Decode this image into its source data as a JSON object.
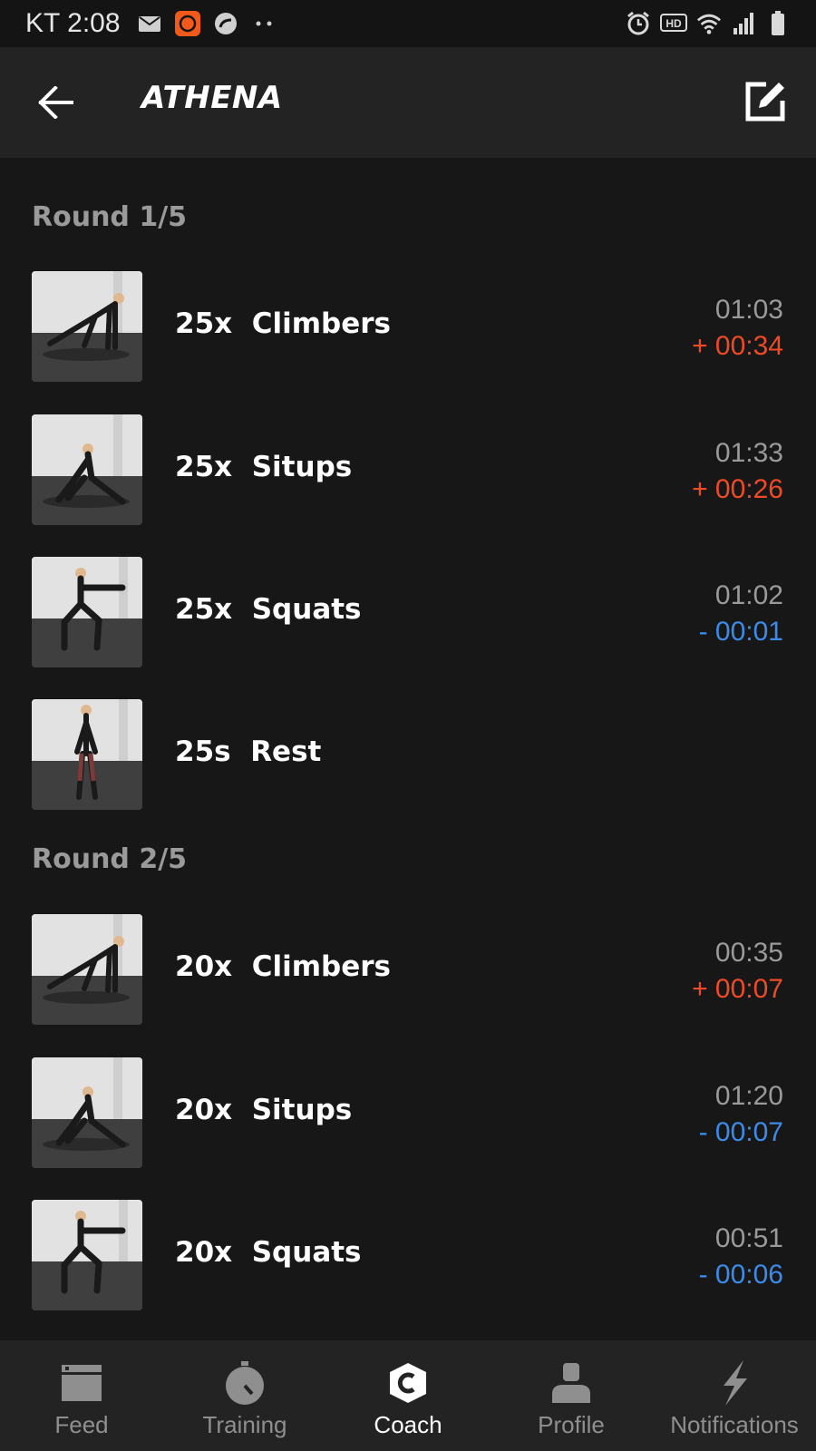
{
  "status_bar": {
    "time": "KT 2:08",
    "left_icons": [
      "mail-icon",
      "app-badge-icon",
      "sync-icon",
      "more-dots-icon"
    ],
    "right_icons": [
      "alarm-icon",
      "hd-icon",
      "wifi-icon",
      "signal-icon",
      "battery-icon"
    ],
    "hd_text": "HD"
  },
  "app_bar": {
    "title": "ATHENA",
    "back_icon": "arrow-left-icon",
    "edit_icon": "edit-icon"
  },
  "rounds": [
    {
      "label": "Round 1/5",
      "exercises": [
        {
          "count": "25x",
          "name": "Climbers",
          "time": "01:03",
          "delta": "+ 00:34",
          "delta_sign": "plus",
          "pose": "climber"
        },
        {
          "count": "25x",
          "name": "Situps",
          "time": "01:33",
          "delta": "+ 00:26",
          "delta_sign": "plus",
          "pose": "situp"
        },
        {
          "count": "25x",
          "name": "Squats",
          "time": "01:02",
          "delta": "- 00:01",
          "delta_sign": "minus",
          "pose": "squat"
        },
        {
          "count": "25s",
          "name": "Rest",
          "time": "",
          "delta": "",
          "delta_sign": "",
          "pose": "stand"
        }
      ]
    },
    {
      "label": "Round 2/5",
      "exercises": [
        {
          "count": "20x",
          "name": "Climbers",
          "time": "00:35",
          "delta": "+ 00:07",
          "delta_sign": "plus",
          "pose": "climber"
        },
        {
          "count": "20x",
          "name": "Situps",
          "time": "01:20",
          "delta": "- 00:07",
          "delta_sign": "minus",
          "pose": "situp"
        },
        {
          "count": "20x",
          "name": "Squats",
          "time": "00:51",
          "delta": "- 00:06",
          "delta_sign": "minus",
          "pose": "squat"
        }
      ]
    }
  ],
  "bottom_nav": [
    {
      "label": "Feed",
      "icon": "feed-icon",
      "active": false
    },
    {
      "label": "Training",
      "icon": "stopwatch-icon",
      "active": false
    },
    {
      "label": "Coach",
      "icon": "coach-icon",
      "active": true
    },
    {
      "label": "Profile",
      "icon": "profile-icon",
      "active": false
    },
    {
      "label": "Notifications",
      "icon": "lightning-icon",
      "active": false
    }
  ],
  "colors": {
    "background": "#171717",
    "bar": "#232323",
    "delta_plus": "#ef4a26",
    "delta_minus": "#3d8be8",
    "muted": "#9a9a9a"
  }
}
